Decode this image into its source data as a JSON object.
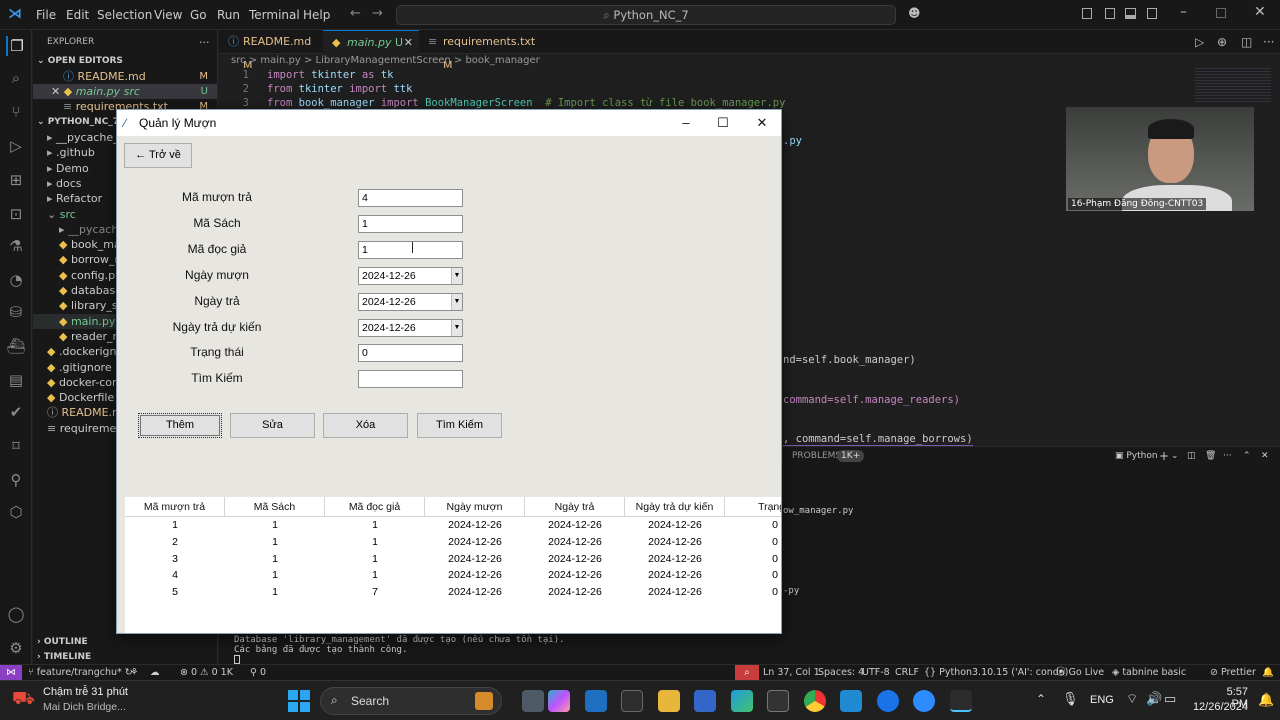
{
  "vscode": {
    "menu": [
      "File",
      "Edit",
      "Selection",
      "View",
      "Go",
      "Run",
      "Terminal",
      "Help"
    ],
    "search": "Python_NC_7",
    "explorer": {
      "title": "EXPLORER",
      "open_editors": "OPEN EDITORS",
      "open_files": [
        {
          "name": "README.md",
          "mark": "M"
        },
        {
          "name": "main.py src",
          "mark": "U"
        },
        {
          "name": "requirements.txt",
          "mark": "M"
        }
      ],
      "project": "PYTHON_NC_7",
      "tree": [
        "__pycache__",
        ".github",
        "Demo",
        "docs",
        "Refactor",
        "src",
        "__pycache__",
        "book_ma",
        "borrow_m",
        "config.py",
        "database",
        "library_st",
        "main.py",
        "reader_m",
        ".dockerign",
        ".gitignore",
        "docker-cor",
        "Dockerfile",
        "README.m",
        "requireme"
      ],
      "outline": "OUTLINE",
      "timeline": "TIMELINE"
    },
    "tabs": [
      {
        "label": "README.md",
        "mark": "M"
      },
      {
        "label": "main.py",
        "mark": "U"
      },
      {
        "label": "requirements.txt",
        "mark": "M"
      }
    ],
    "breadcrumb": "src > main.py > LibraryManagementScreen > book_manager",
    "code": {
      "l1_kw": "import",
      "l1_rest": " tkinter ",
      "l1_as": "as",
      "l1_alias": " tk",
      "l2_kw": "from",
      "l2_rest": " tkinter ",
      "l2_imp": "import",
      "l2_alias": " ttk",
      "l3_kw": "from",
      "l3_rest": " book_manager ",
      "l3_imp": "import",
      "l3_cls": " BookManagerScreen",
      "l3_cm": "  # Import class từ file book_manager.py",
      "frag1": ".py",
      "frag2": "nd=self.book_manager)",
      "frag3": "command=self.manage_readers)",
      "frag4": ", command=self.manage_borrows)",
      "frag5": "ow_manager.py",
      "frag6": "-py"
    },
    "panel": {
      "problems": "PROBLEMS",
      "count": "1K+",
      "shell": "Python"
    },
    "terminal": [
      "Database 'library_management' đã được tạo (nếu chưa tồn tại).",
      "Các bảng đã được tạo thành công."
    ],
    "status": {
      "branch": "feature/trangchu*",
      "errors": "⊗ 0 ⚠ 0 1K",
      "ports": "0",
      "position": "Ln 37, Col 1",
      "spaces": "Spaces: 4",
      "encoding": "UTF-8",
      "eol": "CRLF",
      "lang": "Python",
      "interp": "3.10.15 ('AI': conda)",
      "golive": "Go Live",
      "tabnine": "tabnine basic",
      "prettier": "Prettier"
    }
  },
  "webcam": {
    "label": "16-Phạm Đăng Đông-CNTT03"
  },
  "app": {
    "title": "Quản lý Mượn",
    "back": "← Trở về",
    "fields": [
      {
        "label": "Mã mượn trả",
        "value": "4",
        "type": "entry"
      },
      {
        "label": "Mã Sách",
        "value": "1",
        "type": "entry"
      },
      {
        "label": "Mã đọc giả",
        "value": "1",
        "type": "entry"
      },
      {
        "label": "Ngày mượn",
        "value": "2024-12-26",
        "type": "combo"
      },
      {
        "label": "Ngày trả",
        "value": "2024-12-26",
        "type": "combo"
      },
      {
        "label": "Ngày trả dự kiến",
        "value": "2024-12-26",
        "type": "combo"
      },
      {
        "label": "Trạng thái",
        "value": "0",
        "type": "entry"
      },
      {
        "label": "Tìm Kiếm",
        "value": "",
        "type": "entry"
      }
    ],
    "buttons": {
      "add": "Thêm",
      "edit": "Sửa",
      "delete": "Xóa",
      "search": "Tìm Kiếm"
    },
    "table": {
      "columns": [
        "Mã mượn trả",
        "Mã Sách",
        "Mã đọc giả",
        "Ngày mượn",
        "Ngày trả",
        "Ngày trả dự kiến",
        "Trạng t"
      ],
      "rows": [
        [
          "1",
          "1",
          "1",
          "2024-12-26",
          "2024-12-26",
          "2024-12-26",
          "0"
        ],
        [
          "2",
          "1",
          "1",
          "2024-12-26",
          "2024-12-26",
          "2024-12-26",
          "0"
        ],
        [
          "3",
          "1",
          "1",
          "2024-12-26",
          "2024-12-26",
          "2024-12-26",
          "0"
        ],
        [
          "4",
          "1",
          "1",
          "2024-12-26",
          "2024-12-26",
          "2024-12-26",
          "0"
        ],
        [
          "5",
          "1",
          "7",
          "2024-12-26",
          "2024-12-26",
          "2024-12-26",
          "0"
        ]
      ]
    }
  },
  "taskbar": {
    "weather_title": "Chậm trễ 31 phút",
    "weather_sub": "Mai Dich Bridge...",
    "search": "Search",
    "lang": "ENG",
    "time": "5:57 PM",
    "date": "12/26/2024"
  }
}
